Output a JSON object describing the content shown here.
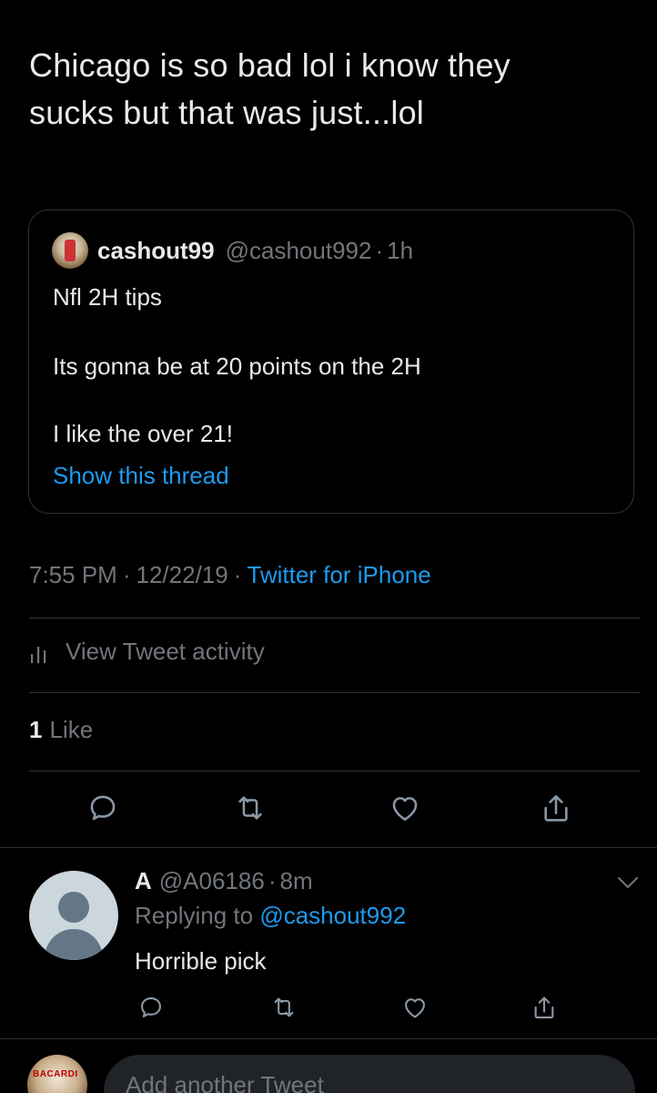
{
  "tweet": {
    "text_line1": "Chicago is so bad lol i know they",
    "text_line2": "sucks but that was just...lol"
  },
  "quoted_tweet": {
    "display_name": "cashout99",
    "handle": "@cashout992",
    "separator": "·",
    "time": "1h",
    "line1": "Nfl 2H tips",
    "line2": "Its gonna be at 20 points on the 2H",
    "line3": "I like the over 21!",
    "show_thread": "Show this thread",
    "avatar_icon": "profile-photo"
  },
  "meta": {
    "time": "7:55 PM",
    "separator": "·",
    "date": "12/22/19",
    "source": "Twitter for iPhone"
  },
  "activity": {
    "label": "View Tweet activity",
    "icon": "bar-chart-icon"
  },
  "likes": {
    "count": "1",
    "label": "Like"
  },
  "actions": [
    {
      "name": "reply",
      "icon": "comment-icon"
    },
    {
      "name": "retweet",
      "icon": "retweet-icon"
    },
    {
      "name": "like",
      "icon": "heart-icon"
    },
    {
      "name": "share",
      "icon": "share-icon"
    }
  ],
  "reply": {
    "display_name": "A",
    "handle": "@A06186",
    "separator": "·",
    "time": "8m",
    "replying_prefix": "Replying to",
    "replying_to": "@cashout992",
    "text": "Horrible pick",
    "avatar_icon": "default-avatar-icon"
  },
  "composer": {
    "placeholder": "Add another Tweet",
    "avatar_logo_text": "BACARDI"
  },
  "colors": {
    "background": "#000000",
    "text": "#e7e9ea",
    "muted": "#71767b",
    "link": "#1d9bf0",
    "divider": "#2f3336"
  }
}
